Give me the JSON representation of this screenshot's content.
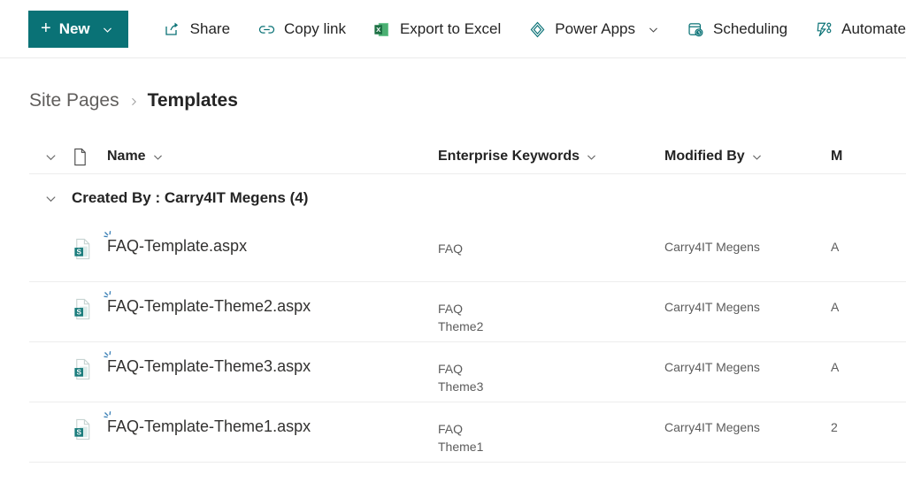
{
  "toolbar": {
    "new_button": {
      "label": "New",
      "plus": "+",
      "icon": "plus-icon",
      "chevron": "chevron-down-icon"
    },
    "items": [
      {
        "label": "Share",
        "icon": "share-icon",
        "has_chevron": false
      },
      {
        "label": "Copy link",
        "icon": "link-icon",
        "has_chevron": false
      },
      {
        "label": "Export to Excel",
        "icon": "excel-icon",
        "has_chevron": false
      },
      {
        "label": "Power Apps",
        "icon": "power-apps-icon",
        "has_chevron": true
      },
      {
        "label": "Scheduling",
        "icon": "scheduling-icon",
        "has_chevron": false
      },
      {
        "label": "Automate",
        "icon": "automate-icon",
        "has_chevron": false
      }
    ]
  },
  "breadcrumb": {
    "root": "Site Pages",
    "separator": "›",
    "current": "Templates"
  },
  "columns": {
    "toggle_icon": "chevron-down-icon",
    "file_type_icon": "document-icon",
    "name": "Name",
    "keywords": "Enterprise Keywords",
    "modified_by": "Modified By",
    "extra_partial": "M"
  },
  "group": {
    "label": "Created By : Carry4IT Megens (4)",
    "toggle_icon": "chevron-down-icon"
  },
  "rows": [
    {
      "icon": "sharepoint-page-icon",
      "badge": "new-item-burst-icon",
      "name": "FAQ-Template.aspx",
      "keywords": [
        "FAQ"
      ],
      "modified_by": "Carry4IT Megens",
      "extra_partial": "A"
    },
    {
      "icon": "sharepoint-page-icon",
      "badge": "new-item-burst-icon",
      "name": "FAQ-Template-Theme2.aspx",
      "keywords": [
        "FAQ",
        "Theme2"
      ],
      "modified_by": "Carry4IT Megens",
      "extra_partial": "A"
    },
    {
      "icon": "sharepoint-page-icon",
      "badge": "new-item-burst-icon",
      "name": "FAQ-Template-Theme3.aspx",
      "keywords": [
        "FAQ",
        "Theme3"
      ],
      "modified_by": "Carry4IT Megens",
      "extra_partial": "A"
    },
    {
      "icon": "sharepoint-page-icon",
      "badge": "new-item-burst-icon",
      "name": "FAQ-Template-Theme1.aspx",
      "keywords": [
        "FAQ",
        "Theme1"
      ],
      "modified_by": "Carry4IT Megens",
      "extra_partial": "2"
    }
  ],
  "colors": {
    "accent_teal": "#0a7276",
    "excel_green": "#217346",
    "text_primary": "#242424",
    "text_secondary": "#5c5c5c",
    "divider": "#ededed"
  }
}
